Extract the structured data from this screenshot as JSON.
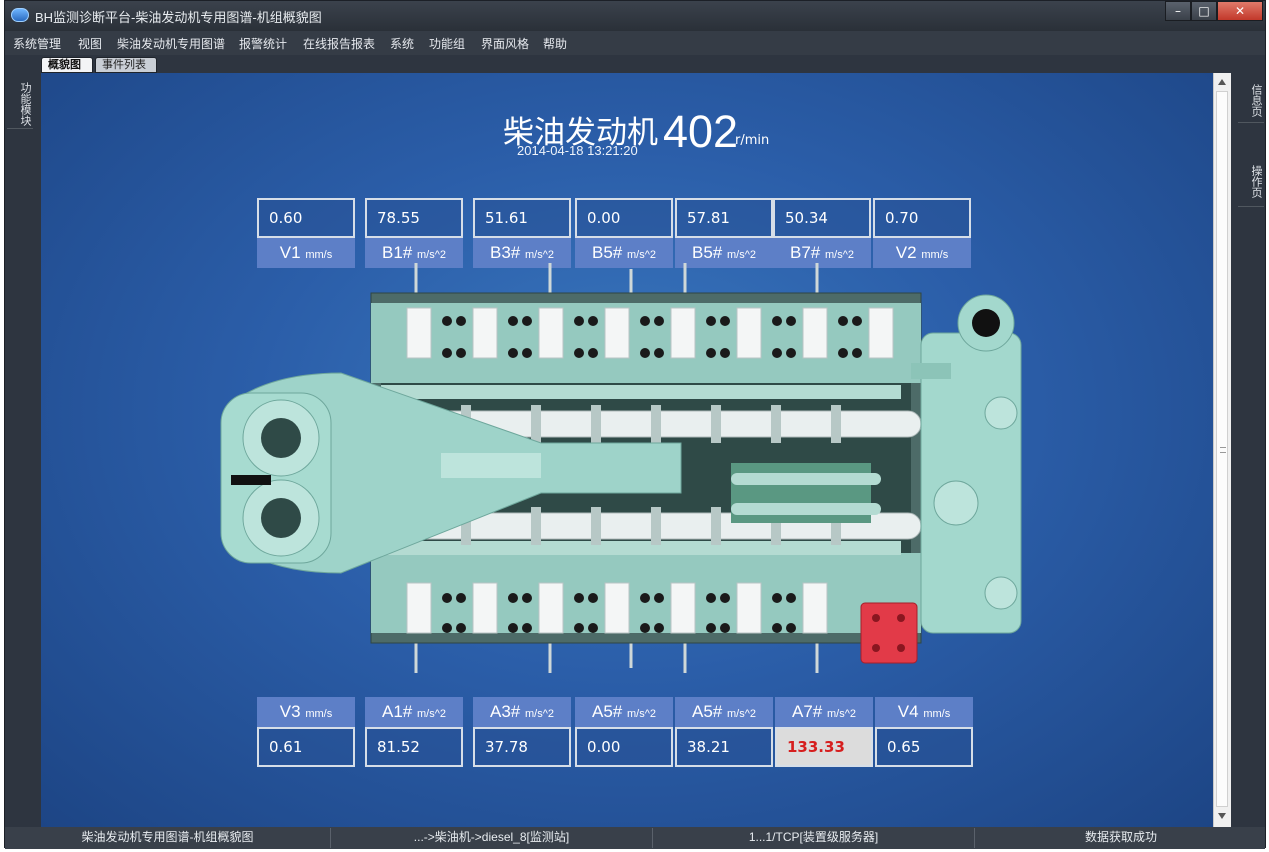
{
  "window": {
    "title": "BH监测诊断平台-柴油发动机专用图谱-机组概貌图",
    "minimize": "–",
    "maximize": "□",
    "close": "✕"
  },
  "menu": [
    "系统管理",
    "视图",
    "柴油发动机专用图谱",
    "报警统计",
    "在线报告报表",
    "系统",
    "功能组",
    "界面风格",
    "帮助"
  ],
  "tabs": [
    "概貌图",
    "事件列表"
  ],
  "side_panels": {
    "left": "功能模块",
    "right_top": "信息页",
    "right_bottom": "操作页"
  },
  "header": {
    "engine_name": "柴油发动机",
    "rpm": "402",
    "rpm_unit": "r/min",
    "timestamp": "2014-04-18 13:21:20"
  },
  "sensors_top": [
    {
      "name": "V1",
      "unit": "mm/s",
      "value": "0.60",
      "alarm": false
    },
    {
      "name": "B1#",
      "unit": "m/s^2",
      "value": "78.55",
      "alarm": false
    },
    {
      "name": "B3#",
      "unit": "m/s^2",
      "value": "51.61",
      "alarm": false
    },
    {
      "name": "B5#",
      "unit": "m/s^2",
      "value": "0.00",
      "alarm": false
    },
    {
      "name": "B5#",
      "unit": "m/s^2",
      "value": "57.81",
      "alarm": false
    },
    {
      "name": "B7#",
      "unit": "m/s^2",
      "value": "50.34",
      "alarm": false
    },
    {
      "name": "V2",
      "unit": "mm/s",
      "value": "0.70",
      "alarm": false
    }
  ],
  "sensors_bottom": [
    {
      "name": "V3",
      "unit": "mm/s",
      "value": "0.61",
      "alarm": false
    },
    {
      "name": "A1#",
      "unit": "m/s^2",
      "value": "81.52",
      "alarm": false
    },
    {
      "name": "A3#",
      "unit": "m/s^2",
      "value": "37.78",
      "alarm": false
    },
    {
      "name": "A5#",
      "unit": "m/s^2",
      "value": "0.00",
      "alarm": false
    },
    {
      "name": "A5#",
      "unit": "m/s^2",
      "value": "38.21",
      "alarm": false
    },
    {
      "name": "A7#",
      "unit": "m/s^2",
      "value": "133.33",
      "alarm": true
    },
    {
      "name": "V4",
      "unit": "mm/s",
      "value": "0.65",
      "alarm": false
    }
  ],
  "status_bar": [
    "柴油发动机专用图谱-机组概貌图",
    "...->柴油机->diesel_8[监测站]",
    "1...1/TCP[装置级服务器]",
    "数据获取成功"
  ],
  "colors": {
    "canvas_blue": "#2b5ea9",
    "label_blue": "#5d7fc7",
    "engine_body": "#9ed3c9",
    "alarm_red": "#d61e1e",
    "alarm_cylinder": "#e23a48"
  }
}
